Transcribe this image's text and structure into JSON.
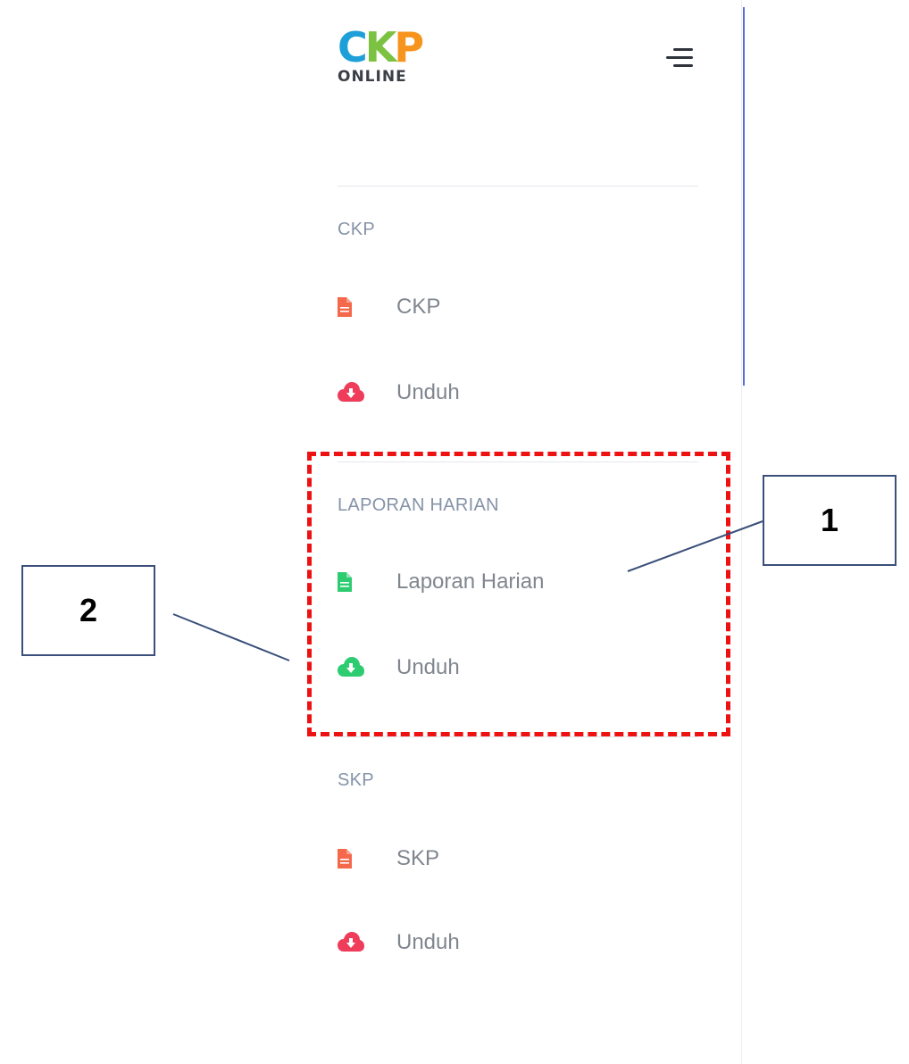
{
  "logo": {
    "letters": [
      "C",
      "K",
      "P"
    ],
    "letter_colors": [
      "#1e9fd8",
      "#7cc242",
      "#f7941d"
    ],
    "subtitle": "ONLINE"
  },
  "header": {
    "menu_icon": "hamburger-menu-icon"
  },
  "sections": [
    {
      "title": "CKP",
      "items": [
        {
          "label": "CKP",
          "icon": "document-icon",
          "icon_color": "#f4694c"
        },
        {
          "label": "Unduh",
          "icon": "cloud-download-icon",
          "icon_color": "#ee3c5a"
        }
      ]
    },
    {
      "title": "LAPORAN HARIAN",
      "items": [
        {
          "label": "Laporan Harian",
          "icon": "document-icon",
          "icon_color": "#2ecc71"
        },
        {
          "label": "Unduh",
          "icon": "cloud-download-icon",
          "icon_color": "#2ecc71"
        }
      ]
    },
    {
      "title": "SKP",
      "items": [
        {
          "label": "SKP",
          "icon": "document-icon",
          "icon_color": "#f4694c"
        },
        {
          "label": "Unduh",
          "icon": "cloud-download-icon",
          "icon_color": "#ee3c5a"
        }
      ]
    }
  ],
  "annotations": {
    "callout_1": "1",
    "callout_2": "2",
    "highlight_color": "#ee1111"
  }
}
